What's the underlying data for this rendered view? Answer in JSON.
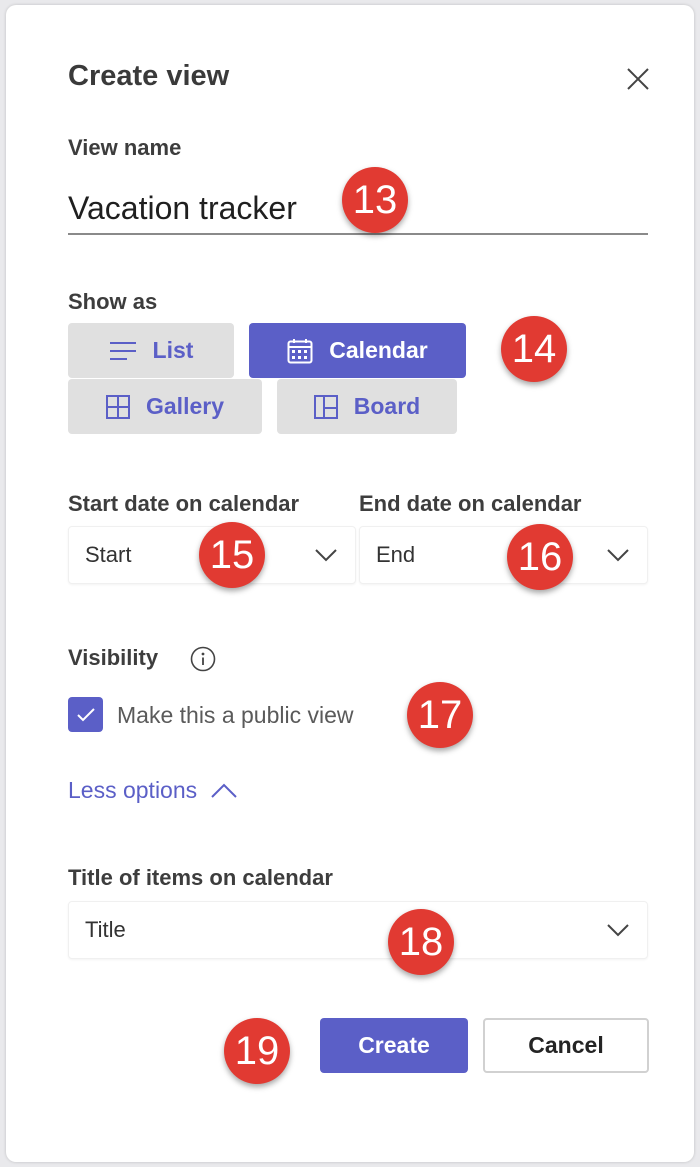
{
  "dialog": {
    "title": "Create view"
  },
  "view_name": {
    "label": "View name",
    "value": "Vacation tracker"
  },
  "show_as": {
    "label": "Show as",
    "options": [
      {
        "label": "List",
        "icon": "list-icon",
        "selected": false
      },
      {
        "label": "Calendar",
        "icon": "calendar-icon",
        "selected": true
      },
      {
        "label": "Gallery",
        "icon": "gallery-icon",
        "selected": false
      },
      {
        "label": "Board",
        "icon": "board-icon",
        "selected": false
      }
    ]
  },
  "start_date": {
    "label": "Start date on calendar",
    "value": "Start"
  },
  "end_date": {
    "label": "End date on calendar",
    "value": "End"
  },
  "visibility": {
    "label": "Visibility",
    "checkbox_label": "Make this a public view",
    "checked": true
  },
  "options_toggle": {
    "label": "Less options"
  },
  "title_items": {
    "label": "Title of items on calendar",
    "value": "Title"
  },
  "footer": {
    "create_label": "Create",
    "cancel_label": "Cancel"
  },
  "callouts": [
    "13",
    "14",
    "15",
    "16",
    "17",
    "18",
    "19"
  ],
  "colors": {
    "accent": "#5b5fc7",
    "callout": "#e13a32",
    "unselected": "#e0e0e0"
  }
}
